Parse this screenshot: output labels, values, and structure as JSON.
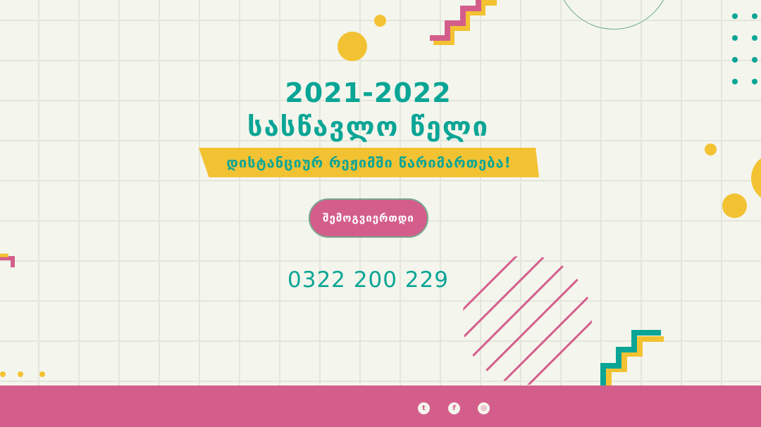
{
  "hero": {
    "year": "2021-2022",
    "title": "სასწავლო წელი",
    "subtitle": "დისტანციურ რეჟიმში წარიმართება!",
    "join_button": "შემოგვიერთდი",
    "phone": "0322 200 229"
  },
  "footer": {
    "social": [
      {
        "icon": "twitter-icon",
        "glyph": "t"
      },
      {
        "icon": "facebook-icon",
        "glyph": "f"
      },
      {
        "icon": "instagram-icon",
        "glyph": "◎"
      }
    ]
  },
  "colors": {
    "teal": "#0aa596",
    "pink": "#d45e8b",
    "yellow": "#f3c232",
    "background": "#f4f5ec"
  }
}
